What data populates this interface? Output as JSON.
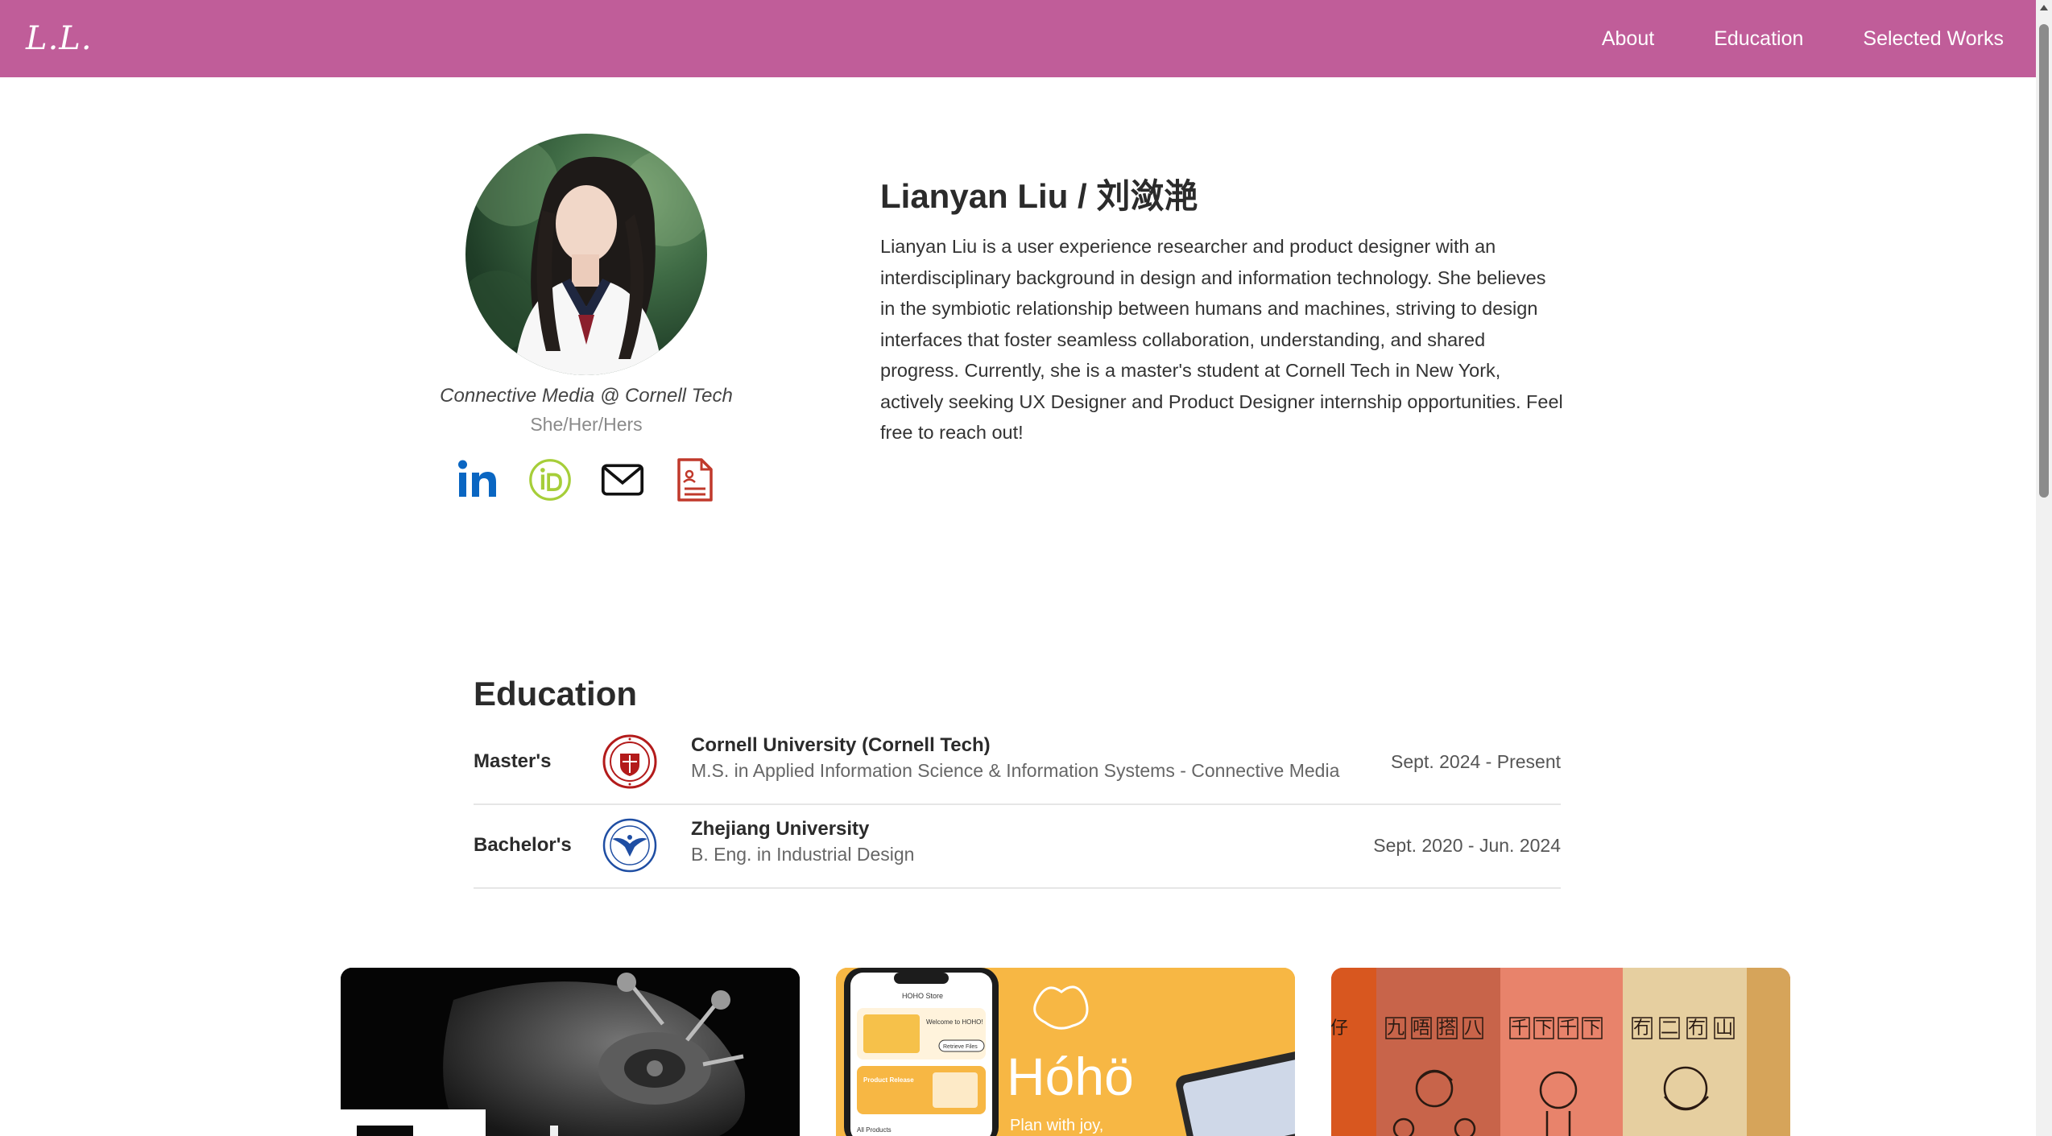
{
  "nav": {
    "logo": "L.L.",
    "links": [
      "About",
      "Education",
      "Selected Works"
    ]
  },
  "profile": {
    "affiliation": "Connective Media @ Cornell Tech",
    "pronouns": "She/Her/Hers",
    "name": "Lianyan Liu / 刘潋滟",
    "bio": "Lianyan Liu is a user experience researcher and product designer with an interdisciplinary background in design and information technology. She believes in the symbiotic relationship between humans and machines, striving to design interfaces that foster seamless collaboration, understanding, and shared progress. Currently, she is a master's student at Cornell Tech in New York, actively seeking UX Designer and Product Designer internship opportunities. Feel free to reach out!",
    "social_icons": [
      "linkedin-icon",
      "orcid-icon",
      "email-icon",
      "resume-icon"
    ]
  },
  "education": {
    "title": "Education",
    "rows": [
      {
        "degree": "Master's",
        "school": "Cornell University (Cornell Tech)",
        "program": "M.S. in Applied Information Science & Information Systems - Connective Media",
        "dates": "Sept. 2024 - Present"
      },
      {
        "degree": "Bachelor's",
        "school": "Zhejiang University",
        "program": "B. Eng. in Industrial Design",
        "dates": "Sept. 2020 - Jun. 2024"
      }
    ]
  },
  "works": {
    "card2": {
      "store_title": "HOHO Store",
      "welcome": "Welcome to HOHO!",
      "retrieve": "Retrieve Files",
      "release": "Product Release",
      "all_products": "All Products",
      "brand": "Hóhö",
      "tagline": "Plan with joy,"
    },
    "card3": {
      "chars": [
        "仔",
        "九",
        "唔",
        "搭",
        "八",
        "千",
        "下",
        "千",
        "下",
        "冇",
        "二",
        "冇",
        "山"
      ]
    }
  },
  "colors": {
    "nav_bg": "#c05d99",
    "cornell_red": "#b31b1b",
    "zju_blue": "#1f4ea3",
    "linkedin_blue": "#0a66c2",
    "orcid_green": "#a6ce39",
    "resume_red": "#c0392b"
  }
}
